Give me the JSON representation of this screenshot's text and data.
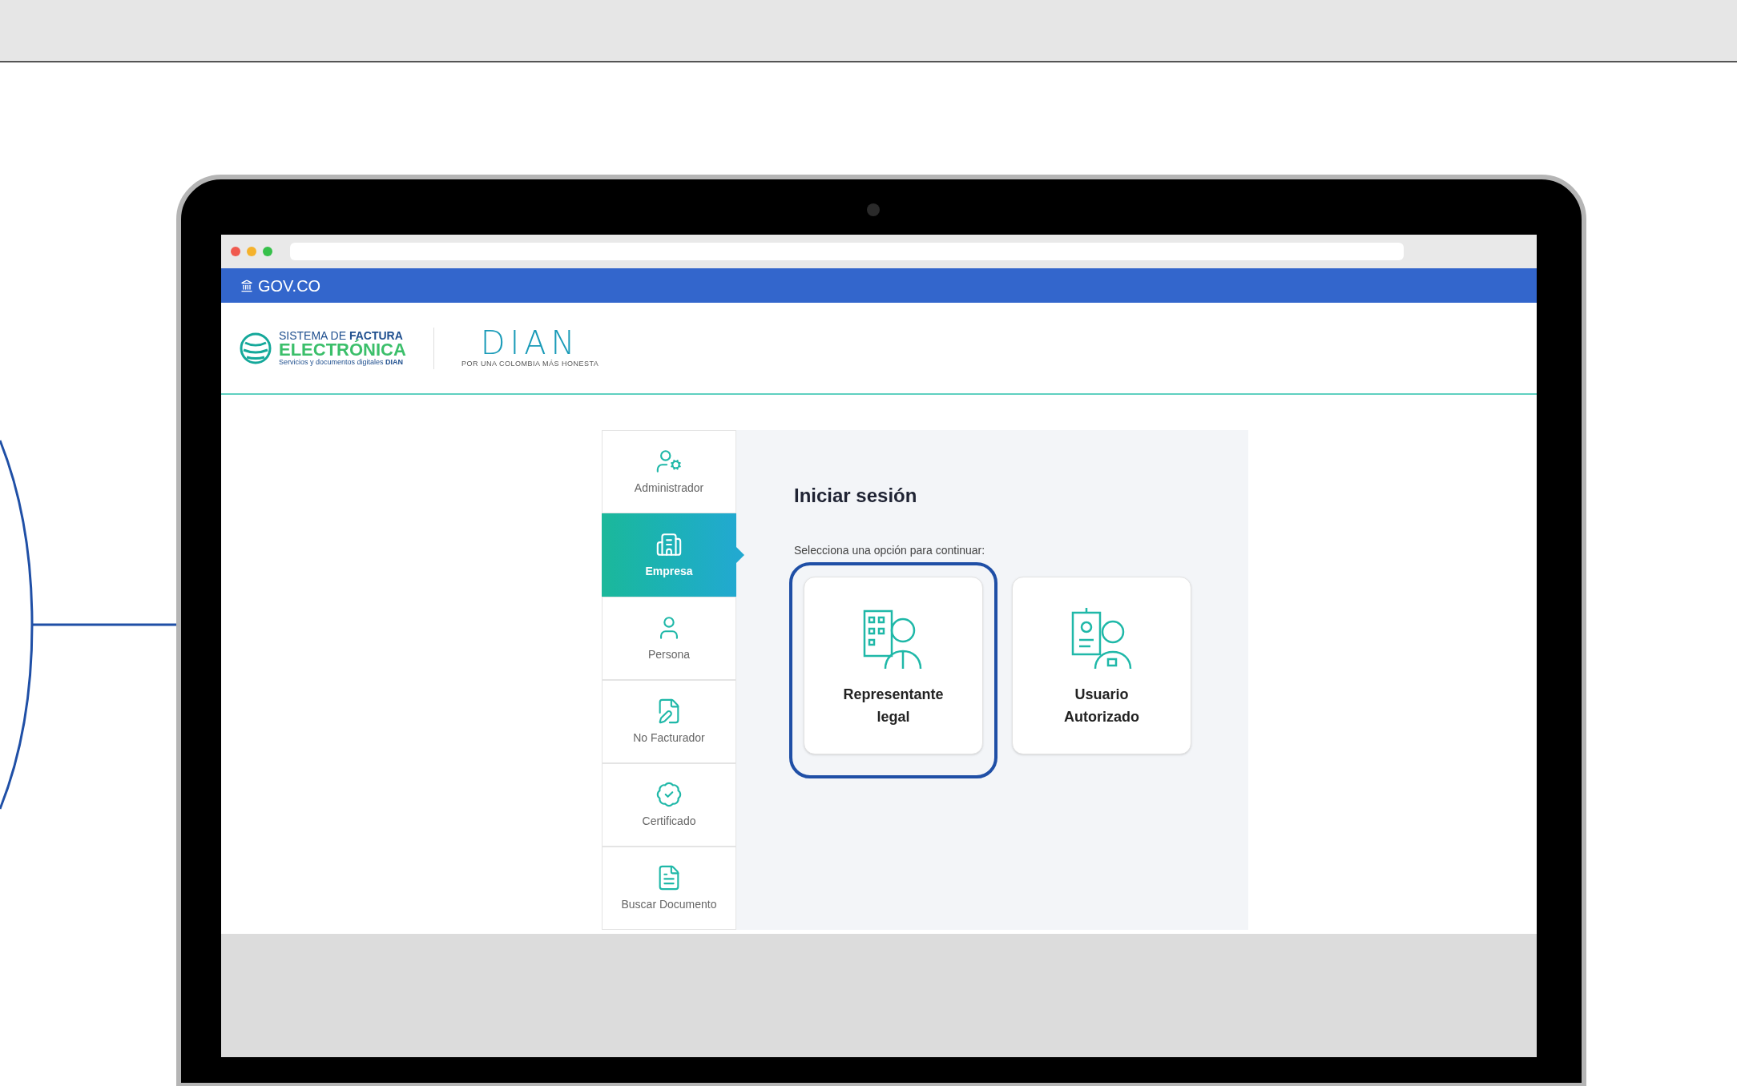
{
  "gov_bar": {
    "label": "GOV.CO"
  },
  "header": {
    "system_logo": {
      "line_1": "SISTEMA DE **FACTURA**",
      "line_2": "ELECTRÓNICA",
      "line_3": "Servicios y documentos digitales **DIAN**"
    },
    "dian_logo": {
      "name": "DIAN",
      "tagline": "POR UNA COLOMBIA MÁS HONESTA"
    }
  },
  "sidebar": {
    "items": [
      {
        "label": "Administrador",
        "selected": false
      },
      {
        "label": "Empresa",
        "selected": true
      },
      {
        "label": "Persona",
        "selected": false
      },
      {
        "label": "No Facturador",
        "selected": false
      },
      {
        "label": "Certificado",
        "selected": false
      },
      {
        "label": "Buscar Documento",
        "selected": false
      }
    ]
  },
  "login": {
    "title": "Iniciar sesión",
    "prompt": "Selecciona una opción para continuar:",
    "options": [
      {
        "label": "Representante legal",
        "selected": true
      },
      {
        "label": "Usuario Autorizado",
        "selected": false
      }
    ]
  }
}
